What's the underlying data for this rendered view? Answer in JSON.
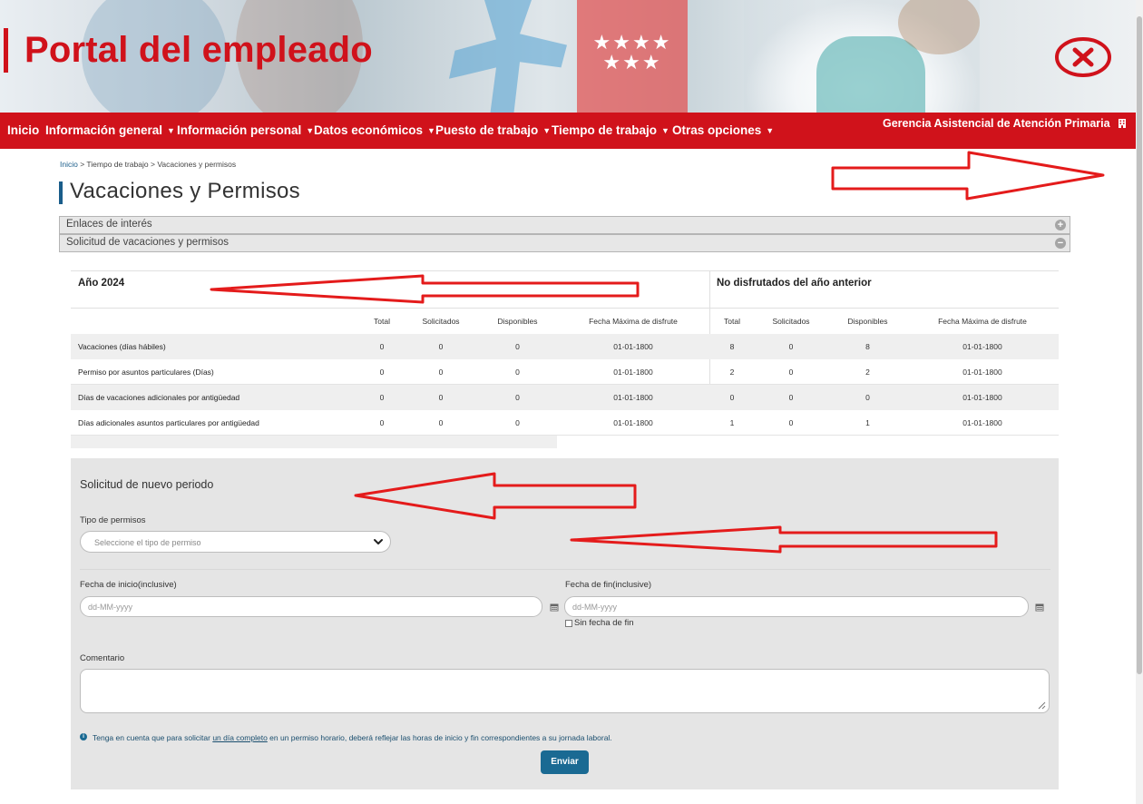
{
  "header": {
    "title": "Portal del empleado",
    "flag_stars": "★★★★\n★★★"
  },
  "nav": {
    "items": [
      {
        "label": "Inicio",
        "has_caret": false
      },
      {
        "label": "Información general",
        "has_caret": true
      },
      {
        "label": "Información personal",
        "has_caret": true
      },
      {
        "label": "Datos económicos",
        "has_caret": true
      },
      {
        "label": "Puesto de trabajo",
        "has_caret": true
      },
      {
        "label": "Tiempo de trabajo",
        "has_caret": true
      },
      {
        "label": "Otras opciones",
        "has_caret": true
      }
    ],
    "organization": "Gerencia Asistencial de Atención Primaria",
    "org_icon": "building-icon",
    "background_color": "#d0121b"
  },
  "breadcrumb": {
    "home": "Inicio",
    "sep": ">",
    "level2": "Tiempo de trabajo",
    "level3": "Vacaciones y permisos"
  },
  "page_title": "Vacaciones y Permisos",
  "accordions": [
    {
      "label": "Enlaces de interés",
      "icon": "plus-circle-icon",
      "expanded": false
    },
    {
      "label": "Solicitud de vacaciones y permisos",
      "icon": "minus-circle-icon",
      "expanded": true
    }
  ],
  "balances": {
    "current_year_title": "Año 2024",
    "previous_year_title": "No disfrutados del año anterior",
    "columns": [
      "Total",
      "Solicitados",
      "Disponibles",
      "Fecha Máxima de disfrute"
    ],
    "rows": [
      {
        "label": "Vacaciones (días hábiles)",
        "current": [
          "0",
          "0",
          "0",
          "01-01-1800"
        ],
        "previous": [
          "8",
          "0",
          "8",
          "01-01-1800"
        ]
      },
      {
        "label": "Permiso por asuntos particulares (Días)",
        "current": [
          "0",
          "0",
          "0",
          "01-01-1800"
        ],
        "previous": [
          "2",
          "0",
          "2",
          "01-01-1800"
        ]
      },
      {
        "label": "Días de vacaciones adicionales por antigüedad",
        "current": [
          "0",
          "0",
          "0",
          "01-01-1800"
        ],
        "previous": [
          "0",
          "0",
          "0",
          "01-01-1800"
        ]
      },
      {
        "label": "Días adicionales asuntos particulares por antigüedad",
        "current": [
          "0",
          "0",
          "0",
          "01-01-1800"
        ],
        "previous": [
          "1",
          "0",
          "1",
          "01-01-1800"
        ]
      }
    ]
  },
  "form": {
    "title": "Solicitud de nuevo periodo",
    "permission_type_label": "Tipo de permisos",
    "permission_type_selected": "Seleccione el tipo de permiso",
    "start_date_label": "Fecha de inicio(inclusive)",
    "start_date_placeholder": "dd-MM-yyyy",
    "end_date_label": "Fecha de fin(inclusive)",
    "end_date_placeholder": "dd-MM-yyyy",
    "no_end_date_label": "Sin fecha de fin",
    "no_end_date_checked": false,
    "comment_label": "Comentario",
    "comment_value": "",
    "info_before": "Tenga en cuenta que para solicitar ",
    "info_link": "un día completo",
    "info_after": " en un permiso horario, deberá reflejar las horas de inicio y fin correspondientes a su jornada laboral.",
    "submit_label": "Enviar",
    "accent_color": "#1a6a93"
  }
}
